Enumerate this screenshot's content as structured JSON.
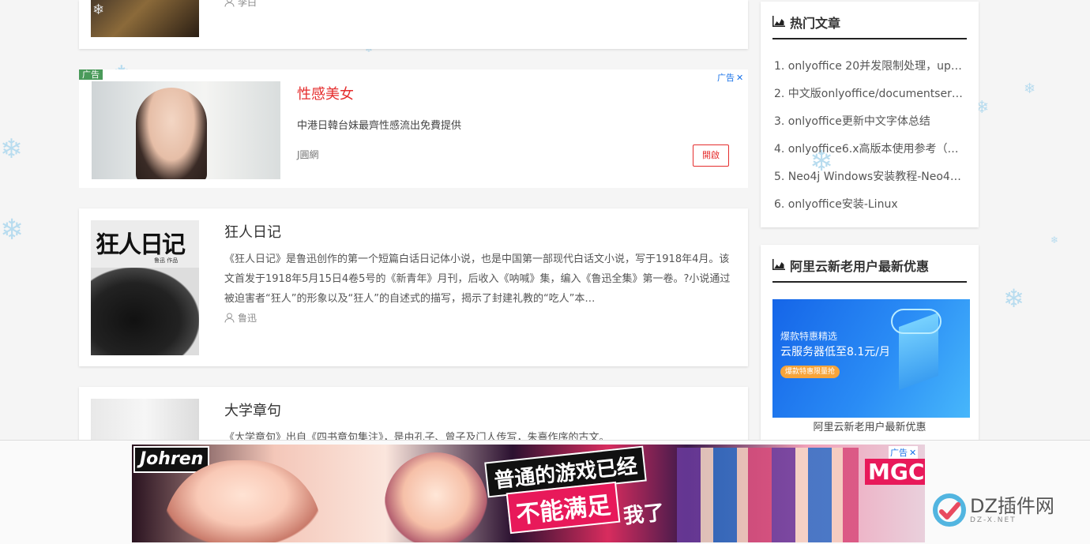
{
  "ad_top": {
    "tag": "广告",
    "corner_label": "广告",
    "close_symbol": "✕",
    "headline": "性感美女",
    "description": "中港日韓台妹最齊性感流出免費提供",
    "source": "J圓網",
    "open_button": "開啟"
  },
  "posts": [
    {
      "author": "李白"
    },
    {
      "title": "狂人日记",
      "excerpt": "《狂人日记》是鲁迅创作的第一个短篇白话日记体小说，也是中国第一部现代白话文小说，写于1918年4月。该文首发于1918年5月15日4卷5号的《新青年》月刊，后收入《呐喊》集，编入《鲁迅全集》第一卷。?小说通过被迫害者“狂人”的形象以及“狂人”的自述式的描写，揭示了封建礼教的“吃人”本…",
      "author": "鲁迅",
      "cover_title": "狂人日记",
      "cover_author": "鲁迅 作品"
    },
    {
      "title": "大学章句",
      "excerpt": "《大学章句》出自《四书章句集注》，是由孔子、曾子及门人传写，朱熹作序的古文。"
    }
  ],
  "sidebar": {
    "hot": {
      "title": "热门文章",
      "items": [
        "1. onlyoffice 20并发限制处理，up t...",
        "2. 中文版onlyoffice/documentserv...",
        "3. onlyoffice更新中文字体总结",
        "4. onlyoffice6.x高版本使用参考（主...",
        "5. Neo4j Windows安装教程-Neo4j...",
        "6. onlyoffice安装-Linux"
      ]
    },
    "aliyun": {
      "title": "阿里云新老用户最新优惠",
      "banner_line1": "爆款特惠精选",
      "banner_line2": "云服务器低至8.1元/月",
      "banner_button": "爆款特惠限量抢",
      "caption": "阿里云新老用户最新优惠"
    }
  },
  "ad_bottom": {
    "corner_label": "广告",
    "close_symbol": "✕",
    "brand": "Johren",
    "headline_line1": "普通的游戏已经",
    "headline_line2": "不能满足",
    "headline_tail": "我了",
    "game_logo": "MGCM"
  },
  "watermark": {
    "name": "DZ插件网",
    "domain": "DZ-X.NET"
  },
  "colors": {
    "accent_red": "#e52e2e",
    "link_blue": "#1a73e8",
    "ad_tag_green": "#4a9a5a",
    "snowflake": "#b8dcef"
  }
}
